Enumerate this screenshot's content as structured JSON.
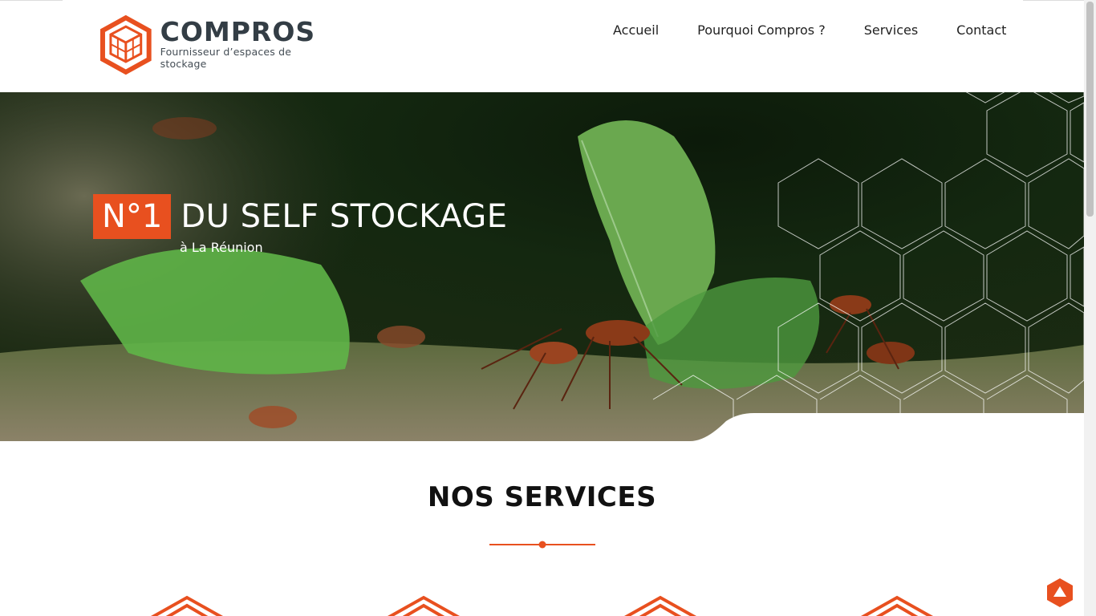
{
  "brand": {
    "name": "COMPROS",
    "tagline": "Fournisseur d’espaces de stockage"
  },
  "nav": {
    "items": [
      {
        "label": "Accueil"
      },
      {
        "label": "Pourquoi Compros ?"
      },
      {
        "label": "Services"
      },
      {
        "label": "Contact"
      }
    ]
  },
  "hero": {
    "badge": "N°1",
    "heading": "DU SELF STOCKAGE",
    "subheading": "à La Réunion"
  },
  "services": {
    "title": "NOS SERVICES"
  },
  "colors": {
    "accent": "#e8501f",
    "logo_text": "#333d45"
  },
  "icons": {
    "logo": "hexagon-cube-icon",
    "back_to_top": "arrow-up-icon",
    "service": "hexagon-outline-icon"
  }
}
